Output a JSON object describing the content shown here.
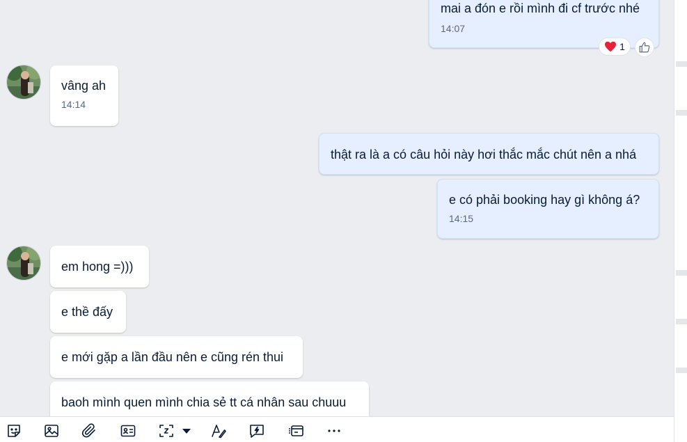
{
  "messages": {
    "m1": {
      "text": "mai a đón e rồi mình đi cf trước nhé",
      "time": "14:07"
    },
    "m2": {
      "text": "vâng ah",
      "time": "14:14"
    },
    "m3": {
      "text": "thật ra là a có câu hỏi này hơi thắc mắc chút nên a nhá"
    },
    "m4": {
      "text": "e có phải booking hay gì không á?",
      "time": "14:15"
    },
    "m5": {
      "text": "em hong =)))"
    },
    "m6": {
      "text": "e thề đấy"
    },
    "m7": {
      "text": "e mới gặp a lần đầu nên e cũng rén thui"
    },
    "m8": {
      "text": "baoh mình quen mình chia sẻ tt cá nhân sau chuuu"
    }
  },
  "reactions": {
    "heart_count": "1"
  },
  "colors": {
    "background": "#ebedf0",
    "incoming_bubble": "#ffffff",
    "outgoing_bubble": "#e5efff",
    "heart": "#e8213b",
    "icon": "#081c36"
  },
  "toolbar": {
    "icons": [
      "sticker-icon",
      "image-icon",
      "attachment-icon",
      "contact-card-icon",
      "screenshot-icon",
      "dropdown-arrow-icon",
      "text-format-icon",
      "quick-message-icon",
      "card-icon",
      "more-icon"
    ]
  }
}
